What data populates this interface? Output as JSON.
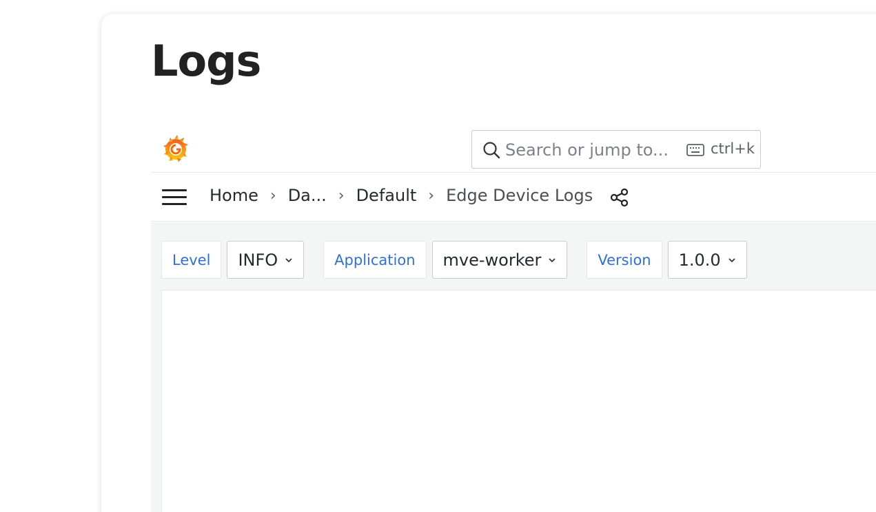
{
  "page": {
    "title": "Logs"
  },
  "topbar": {
    "search_placeholder": "Search or jump to...",
    "shortcut": "ctrl+k"
  },
  "breadcrumb": {
    "items": [
      "Home",
      "Da...",
      "Default",
      "Edge Device Logs"
    ]
  },
  "variables": [
    {
      "label": "Level",
      "value": "INFO"
    },
    {
      "label": "Application",
      "value": "mve-worker"
    },
    {
      "label": "Version",
      "value": "1.0.0"
    }
  ],
  "colors": {
    "accent": "#2f6fdc",
    "logo_orange": "#f46800",
    "logo_yellow": "#fbca0a"
  }
}
